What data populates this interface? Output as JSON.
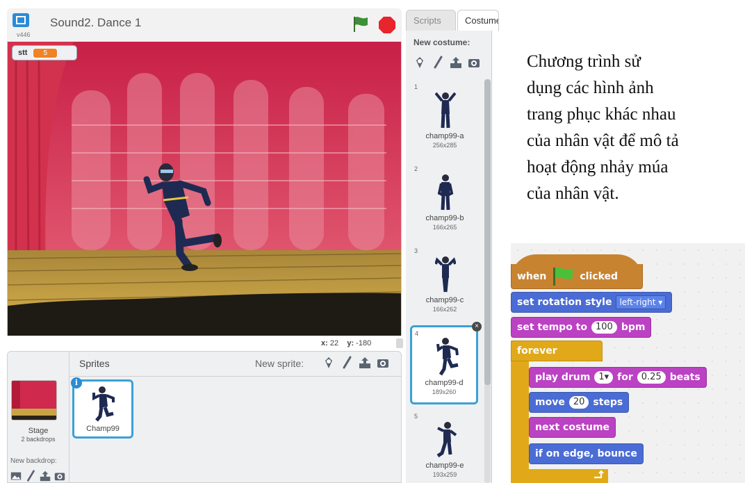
{
  "stage": {
    "version": "v446",
    "title": "Sound2. Dance 1",
    "monitor": {
      "label": "stt",
      "value": "5"
    },
    "coords": {
      "x_label": "x:",
      "x_value": "22",
      "y_label": "y:",
      "y_value": "-180"
    }
  },
  "sprite_pane": {
    "sprites_label": "Sprites",
    "new_sprite_label": "New sprite:",
    "stage_label": "Stage",
    "backdrops_count": "2 backdrops",
    "new_backdrop_label": "New backdrop:",
    "sprites": [
      {
        "name": "Champ99",
        "info": "i"
      }
    ]
  },
  "tabs": [
    {
      "label": "Scripts"
    },
    {
      "label": "Costumes"
    }
  ],
  "costume_pane": {
    "new_costume_label": "New costume:",
    "costumes": [
      {
        "num": "1",
        "name": "champ99-a",
        "size": "256x285"
      },
      {
        "num": "2",
        "name": "champ99-b",
        "size": "166x265"
      },
      {
        "num": "3",
        "name": "champ99-c",
        "size": "166x262"
      },
      {
        "num": "4",
        "name": "champ99-d",
        "size": "189x260"
      },
      {
        "num": "5",
        "name": "champ99-e",
        "size": "193x259"
      }
    ],
    "delete_glyph": "×"
  },
  "description": {
    "lines": [
      "Chương trình sử",
      "dụng các hình ảnh",
      "trang phục khác nhau",
      "của nhân vật để mô tả",
      "hoạt động nhảy múa",
      "của nhân vật."
    ]
  },
  "scripts": {
    "when": "when",
    "clicked": "clicked",
    "set_rotation": "set rotation style",
    "rotation_value": "left-right",
    "set_tempo": "set tempo to",
    "tempo_value": "100",
    "bpm": "bpm",
    "forever": "forever",
    "play_drum": "play drum",
    "drum_value": "1",
    "for": "for",
    "beats_value": "0.25",
    "beats": "beats",
    "move": "move",
    "move_value": "20",
    "steps": "steps",
    "next_costume": "next costume",
    "bounce": "if on edge, bounce"
  },
  "colors": {
    "event": "#c88330",
    "motion": "#4a6cd4",
    "sound": "#bb42c3",
    "control": "#e1a91a",
    "selection": "#3aa0d8",
    "stop": "#e8242c",
    "flag": "#3d8f3a"
  },
  "icons": [
    "fullscreen-icon",
    "green-flag-icon",
    "stop-icon",
    "sprite-library-icon",
    "paint-icon",
    "upload-icon",
    "camera-icon",
    "info-icon",
    "delete-icon"
  ]
}
